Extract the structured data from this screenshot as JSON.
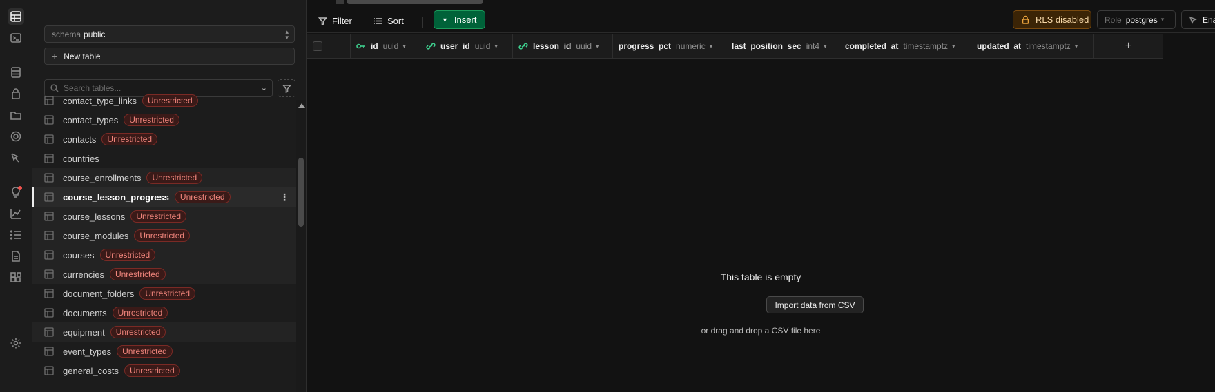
{
  "sidebar": {
    "schema_label": "schema",
    "schema_value": "public",
    "new_table_label": "New table",
    "search_placeholder": "Search tables...",
    "tables": [
      {
        "name": "contact_type_links",
        "badge": "Unrestricted"
      },
      {
        "name": "contact_types",
        "badge": "Unrestricted"
      },
      {
        "name": "contacts",
        "badge": "Unrestricted"
      },
      {
        "name": "countries",
        "badge": ""
      },
      {
        "name": "course_enrollments",
        "badge": "Unrestricted"
      },
      {
        "name": "course_lesson_progress",
        "badge": "Unrestricted"
      },
      {
        "name": "course_lessons",
        "badge": "Unrestricted"
      },
      {
        "name": "course_modules",
        "badge": "Unrestricted"
      },
      {
        "name": "courses",
        "badge": "Unrestricted"
      },
      {
        "name": "currencies",
        "badge": "Unrestricted"
      },
      {
        "name": "document_folders",
        "badge": "Unrestricted"
      },
      {
        "name": "documents",
        "badge": "Unrestricted"
      },
      {
        "name": "equipment",
        "badge": "Unrestricted"
      },
      {
        "name": "event_types",
        "badge": "Unrestricted"
      },
      {
        "name": "general_costs",
        "badge": "Unrestricted"
      }
    ]
  },
  "toolbar": {
    "filter_label": "Filter",
    "sort_label": "Sort",
    "insert_label": "Insert",
    "rls_label": "RLS disabled",
    "role_label": "Role",
    "role_value": "postgres",
    "enable_label": "Enable"
  },
  "columns": [
    {
      "name": "id",
      "type": "uuid",
      "key": "primary"
    },
    {
      "name": "user_id",
      "type": "uuid",
      "key": "foreign"
    },
    {
      "name": "lesson_id",
      "type": "uuid",
      "key": "foreign"
    },
    {
      "name": "progress_pct",
      "type": "numeric",
      "key": ""
    },
    {
      "name": "last_position_sec",
      "type": "int4",
      "key": ""
    },
    {
      "name": "completed_at",
      "type": "timestamptz",
      "key": ""
    },
    {
      "name": "updated_at",
      "type": "timestamptz",
      "key": ""
    }
  ],
  "add_column_label": "+",
  "empty_state": {
    "title": "This table is empty",
    "import_label": "Import data from CSV",
    "hint": "or drag and drop a CSV file here"
  },
  "colors": {
    "accent_green": "#006239",
    "badge_red": "#f0857c",
    "rls_amber": "#e8a13c",
    "pk_green": "#3ecf8e"
  }
}
